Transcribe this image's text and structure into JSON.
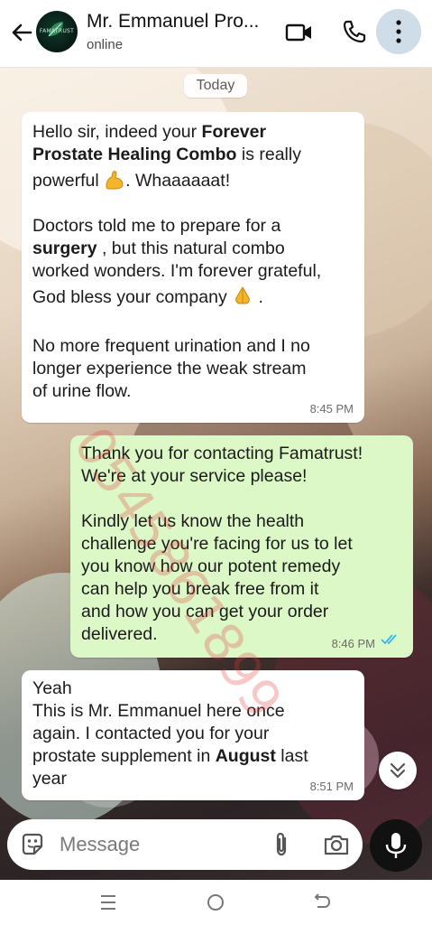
{
  "header": {
    "contact_name": "Mr. Emmanuel Pro...",
    "status": "online",
    "avatar_text": "FAMATRUST"
  },
  "chat": {
    "date_chip": "Today",
    "messages": [
      {
        "direction": "incoming",
        "time": "8:45 PM",
        "lines": {
          "l1a": "Hello sir, indeed your ",
          "l1b": "Forever",
          "l2a": "Prostate Healing Combo",
          "l2b": " is really",
          "l3a": "powerful ",
          "l3b": ". Whaaaaaat!",
          "l4": "Doctors told me to prepare for a",
          "l5a": "surgery",
          "l5b": " , but this natural combo",
          "l6": "worked wonders. I'm forever grateful,",
          "l7a": "God bless your company ",
          "l7b": " .",
          "l8": "No more frequent urination and I no",
          "l9": "longer experience the weak stream",
          "l10": "of urine flow."
        }
      },
      {
        "direction": "outgoing",
        "time": "8:46 PM",
        "read": true,
        "lines": {
          "l1": "Thank you for contacting Famatrust!",
          "l2": "We're at your service please!",
          "l3": "Kindly let us know the health",
          "l4": "challenge you're facing for us to let",
          "l5": "you know how our potent remedy",
          "l6": "can help you break free from it",
          "l7": "and how you can get your order",
          "l8": "delivered."
        }
      },
      {
        "direction": "incoming",
        "time": "8:51 PM",
        "lines": {
          "l1": "Yeah",
          "l2": "This is Mr. Emmanuel here once",
          "l3": "again. I contacted you for your",
          "l4a": "prostate supplement in ",
          "l4b": "August",
          "l4c": " last",
          "l5": "year"
        }
      }
    ],
    "watermark": "0545861899"
  },
  "composer": {
    "placeholder": "Message"
  },
  "icons": {
    "back": "arrow-back-icon",
    "video": "video-call-icon",
    "phone": "phone-call-icon",
    "menu": "more-vert-icon",
    "emoji": "emoji-sticker-icon",
    "attach": "paperclip-icon",
    "camera": "camera-icon",
    "mic": "mic-icon",
    "scroll": "double-chevron-down-icon"
  },
  "colors": {
    "incoming_bubble": "#ffffff",
    "outgoing_bubble": "#dcf8c6",
    "read_ticks": "#34b7f1",
    "watermark": "#e23b3b"
  }
}
